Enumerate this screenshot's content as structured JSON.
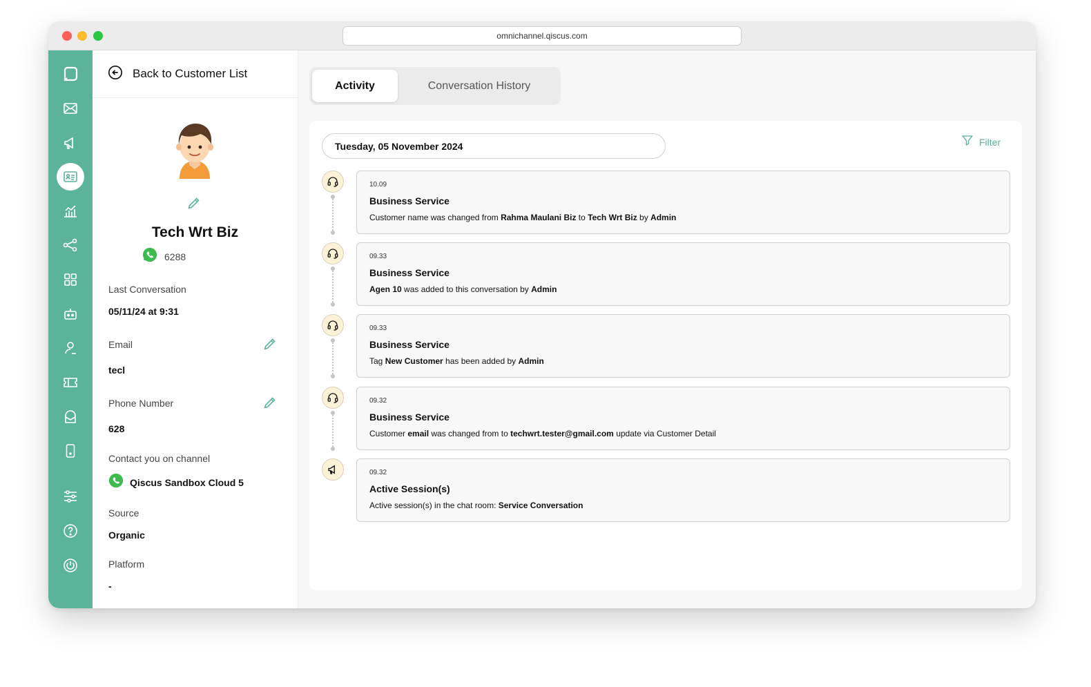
{
  "browser": {
    "url": "omnichannel.qiscus.com"
  },
  "rail": {
    "items": [
      {
        "name": "logo-icon"
      },
      {
        "name": "inbox-icon"
      },
      {
        "name": "broadcast-icon"
      },
      {
        "name": "customer-icon",
        "active": true
      },
      {
        "name": "analytics-icon"
      },
      {
        "name": "integration-icon"
      },
      {
        "name": "apps-icon"
      },
      {
        "name": "bot-icon"
      },
      {
        "name": "agent-icon"
      },
      {
        "name": "ticket-icon"
      },
      {
        "name": "mailbox-icon"
      },
      {
        "name": "mobile-icon"
      },
      {
        "name": "settings-icon"
      },
      {
        "name": "help-icon"
      },
      {
        "name": "logout-icon"
      }
    ],
    "accent": "#5bb39a"
  },
  "profile": {
    "back_label": "Back to Customer List",
    "name": "Tech Wrt Biz",
    "whatsapp_number": "6288",
    "last_conversation_label": "Last Conversation",
    "last_conversation_value": "05/11/24 at 9:31",
    "email_label": "Email",
    "email_value": "tecl",
    "phone_label": "Phone Number",
    "phone_value": "628",
    "channel_label": "Contact you on channel",
    "channel_value": "Qiscus Sandbox Cloud 5",
    "source_label": "Source",
    "source_value": "Organic",
    "platform_label": "Platform",
    "platform_value": "-"
  },
  "tabs": [
    {
      "label": "Activity",
      "active": true
    },
    {
      "label": "Conversation History",
      "active": false
    }
  ],
  "activity": {
    "date": "Tuesday, 05 November 2024",
    "filter_label": "Filter",
    "items": [
      {
        "icon": "headset-icon",
        "time": "10.09",
        "title": "Business Service",
        "parts": [
          {
            "t": "Customer name was changed from ",
            "b": false
          },
          {
            "t": "Rahma Maulani Biz",
            "b": true
          },
          {
            "t": " to ",
            "b": false
          },
          {
            "t": "Tech Wrt Biz",
            "b": true
          },
          {
            "t": " by ",
            "b": false
          },
          {
            "t": "Admin",
            "b": true
          }
        ]
      },
      {
        "icon": "headset-icon",
        "time": "09.33",
        "title": "Business Service",
        "parts": [
          {
            "t": "Agen 10",
            "b": true
          },
          {
            "t": " was added to this conversation by ",
            "b": false
          },
          {
            "t": "Admin",
            "b": true
          }
        ]
      },
      {
        "icon": "headset-icon",
        "time": "09.33",
        "title": "Business Service",
        "parts": [
          {
            "t": "Tag ",
            "b": false
          },
          {
            "t": "New Customer",
            "b": true
          },
          {
            "t": " has been added by ",
            "b": false
          },
          {
            "t": "Admin",
            "b": true
          }
        ]
      },
      {
        "icon": "headset-icon",
        "time": "09.32",
        "title": "Business Service",
        "parts": [
          {
            "t": "Customer ",
            "b": false
          },
          {
            "t": "email",
            "b": true
          },
          {
            "t": " was changed from to ",
            "b": false
          },
          {
            "t": "techwrt.tester@gmail.com",
            "b": true
          },
          {
            "t": " update via Customer Detail",
            "b": false
          }
        ]
      },
      {
        "icon": "megaphone-icon",
        "time": "09.32",
        "title": "Active Session(s)",
        "parts": [
          {
            "t": "Active session(s) in the chat room: ",
            "b": false
          },
          {
            "t": "Service Conversation",
            "b": true
          }
        ]
      }
    ]
  }
}
